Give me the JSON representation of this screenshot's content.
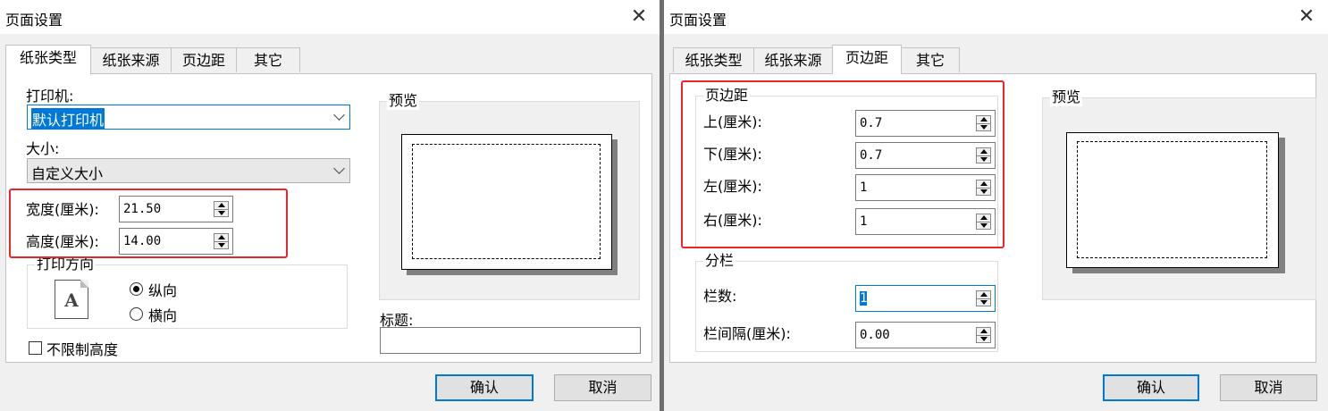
{
  "dialog1": {
    "title": "页面设置",
    "tabs": [
      "纸张类型",
      "纸张来源",
      "页边距",
      "其它"
    ],
    "printer_label": "打印机:",
    "printer_value": "默认打印机",
    "size_label": "大小:",
    "size_value": "自定义大小",
    "width_label": "宽度(厘米):",
    "width_value": "21.50",
    "height_label": "高度(厘米):",
    "height_value": "14.00",
    "orientation_group": "打印方向",
    "orientation_icon_glyph": "A",
    "portrait_label": "纵向",
    "landscape_label": "横向",
    "unlimited_height_label": "不限制高度",
    "preview_label": "预览",
    "caption_label": "标题:",
    "caption_value": "",
    "ok_label": "确认",
    "cancel_label": "取消"
  },
  "dialog2": {
    "title": "页面设置",
    "tabs": [
      "纸张类型",
      "纸张来源",
      "页边距",
      "其它"
    ],
    "margins_group": "页边距",
    "top_label": "上(厘米):",
    "top_value": "0.7",
    "bottom_label": "下(厘米):",
    "bottom_value": "0.7",
    "left_label": "左(厘米):",
    "left_value": "1",
    "right_label": "右(厘米):",
    "right_value": "1",
    "columns_group": "分栏",
    "col_count_label": "栏数:",
    "col_count_value": "1",
    "col_gap_label": "栏间隔(厘米):",
    "col_gap_value": "0.00",
    "preview_label": "预览",
    "ok_label": "确认",
    "cancel_label": "取消"
  },
  "icons": {
    "close": "close-icon",
    "dropdown": "chevron-down-icon",
    "spinner": "spinner-arrows-icon"
  },
  "colors": {
    "highlight_box": "#e8262e",
    "selection": "#0078d7",
    "dialog_bg": "#f0f0f0"
  }
}
